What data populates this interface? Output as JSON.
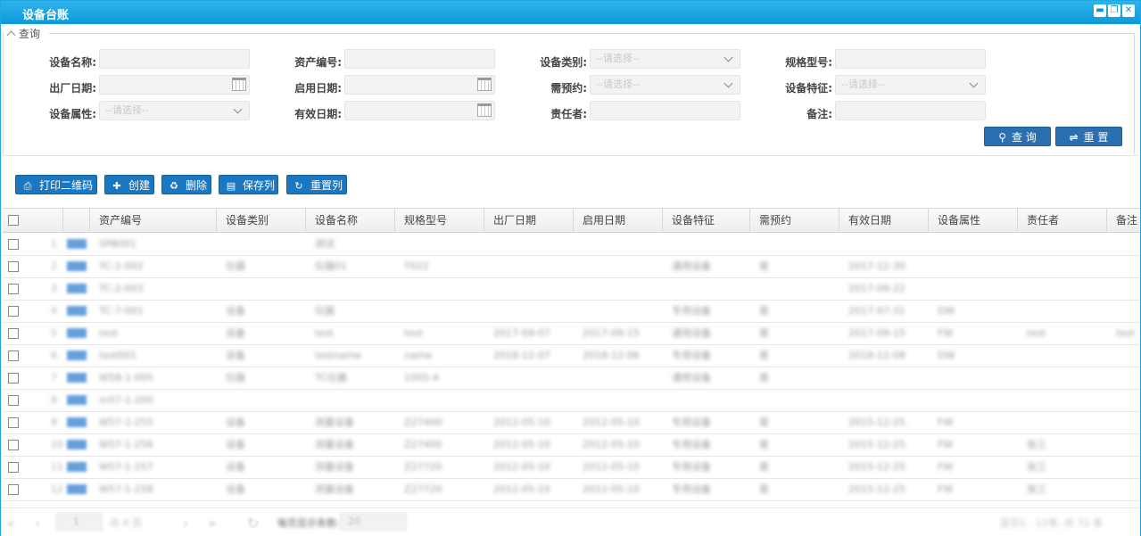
{
  "window": {
    "title": "设备台账"
  },
  "query": {
    "legend": "查询",
    "fields": [
      {
        "label": "设备名称:",
        "value": "",
        "kind": "text"
      },
      {
        "label": "资产编号:",
        "value": "",
        "kind": "text"
      },
      {
        "label": "设备类别:",
        "value": "--请选择--",
        "kind": "select"
      },
      {
        "label": "规格型号:",
        "value": "",
        "kind": "text"
      },
      {
        "label": "出厂日期:",
        "value": "",
        "kind": "date"
      },
      {
        "label": "启用日期:",
        "value": "",
        "kind": "date"
      },
      {
        "label": "需预约:",
        "value": "--请选择--",
        "kind": "select"
      },
      {
        "label": "设备特征:",
        "value": "--请选择--",
        "kind": "select"
      },
      {
        "label": "设备属性:",
        "value": "--请选择--",
        "kind": "select"
      },
      {
        "label": "有效日期:",
        "value": "",
        "kind": "date"
      },
      {
        "label": "责任者:",
        "value": "",
        "kind": "text"
      },
      {
        "label": "备注:",
        "value": "",
        "kind": "text"
      }
    ],
    "search_label": "查 询",
    "reset_label": "重 置"
  },
  "toolbar": {
    "print_qr_label": "打印二维码",
    "create_label": "创建",
    "delete_label": "删除",
    "save_cols_label": "保存列",
    "reset_cols_label": "重置列"
  },
  "grid": {
    "columns": [
      "资产编号",
      "设备类别",
      "设备名称",
      "规格型号",
      "出厂日期",
      "启用日期",
      "设备特征",
      "需预约",
      "有效日期",
      "设备属性",
      "责任者",
      "备注"
    ],
    "rows": [
      [
        "1",
        "SPB001",
        "",
        "测试",
        "",
        "",
        "",
        "",
        "",
        "",
        "",
        "",
        ""
      ],
      [
        "2",
        "TC-2-002",
        "仪器",
        "仪器01",
        "T022",
        "",
        "",
        "通用设备",
        "是",
        "2017-12-30",
        "",
        "",
        ""
      ],
      [
        "3",
        "TC-2-003",
        "",
        "",
        "",
        "",
        "",
        "",
        "",
        "2017-09-22",
        "",
        "",
        ""
      ],
      [
        "4",
        "TC-7-001",
        "设备",
        "仪器",
        "",
        "",
        "",
        "专用设备",
        "是",
        "2017-07-31",
        "DW",
        "",
        ""
      ],
      [
        "5",
        "test",
        "设备",
        "test",
        "test",
        "2017-09-07",
        "2017-09-15",
        "通用设备",
        "是",
        "2017-09-15",
        "FW",
        "test",
        "test"
      ],
      [
        "6",
        "test001",
        "设备",
        "testname",
        "name",
        "2018-12-07",
        "2018-12-06",
        "专用设备",
        "是",
        "2018-12-08",
        "DW",
        "",
        ""
      ],
      [
        "7",
        "W58-1-005",
        "仪器",
        "TC仪器",
        "1005-4",
        "",
        "",
        "通用设备",
        "是",
        "",
        "",
        "",
        ""
      ],
      [
        "8",
        "m57-1-200",
        "",
        "",
        "",
        "",
        "",
        "",
        "",
        "",
        "",
        "",
        ""
      ],
      [
        "9",
        "W57-1-255",
        "设备",
        "测量设备",
        "Z27400",
        "2012-05-10",
        "2012-05-10",
        "专用设备",
        "是",
        "2015-12-25",
        "FW",
        "",
        ""
      ],
      [
        "10",
        "W57-1-256",
        "设备",
        "测量设备",
        "Z27400",
        "2012-05-10",
        "2012-05-10",
        "专用设备",
        "是",
        "2015-12-25",
        "FW",
        "张三",
        ""
      ],
      [
        "11",
        "W57-1-257",
        "设备",
        "测量设备",
        "Z27720",
        "2012-05-10",
        "2012-05-10",
        "专用设备",
        "是",
        "2015-12-25",
        "FW",
        "张三",
        ""
      ],
      [
        "12",
        "W57-1-258",
        "设备",
        "测量设备",
        "Z27720",
        "2012-05-10",
        "2012-05-10",
        "专用设备",
        "是",
        "2015-12-25",
        "FW",
        "张三",
        ""
      ]
    ]
  },
  "pager": {
    "page_input": "1",
    "page_of": "共 4 页",
    "page_size_label": "每页显示条数:",
    "page_size": "20",
    "summary": "显示1 - 12条, 共 72 条"
  }
}
